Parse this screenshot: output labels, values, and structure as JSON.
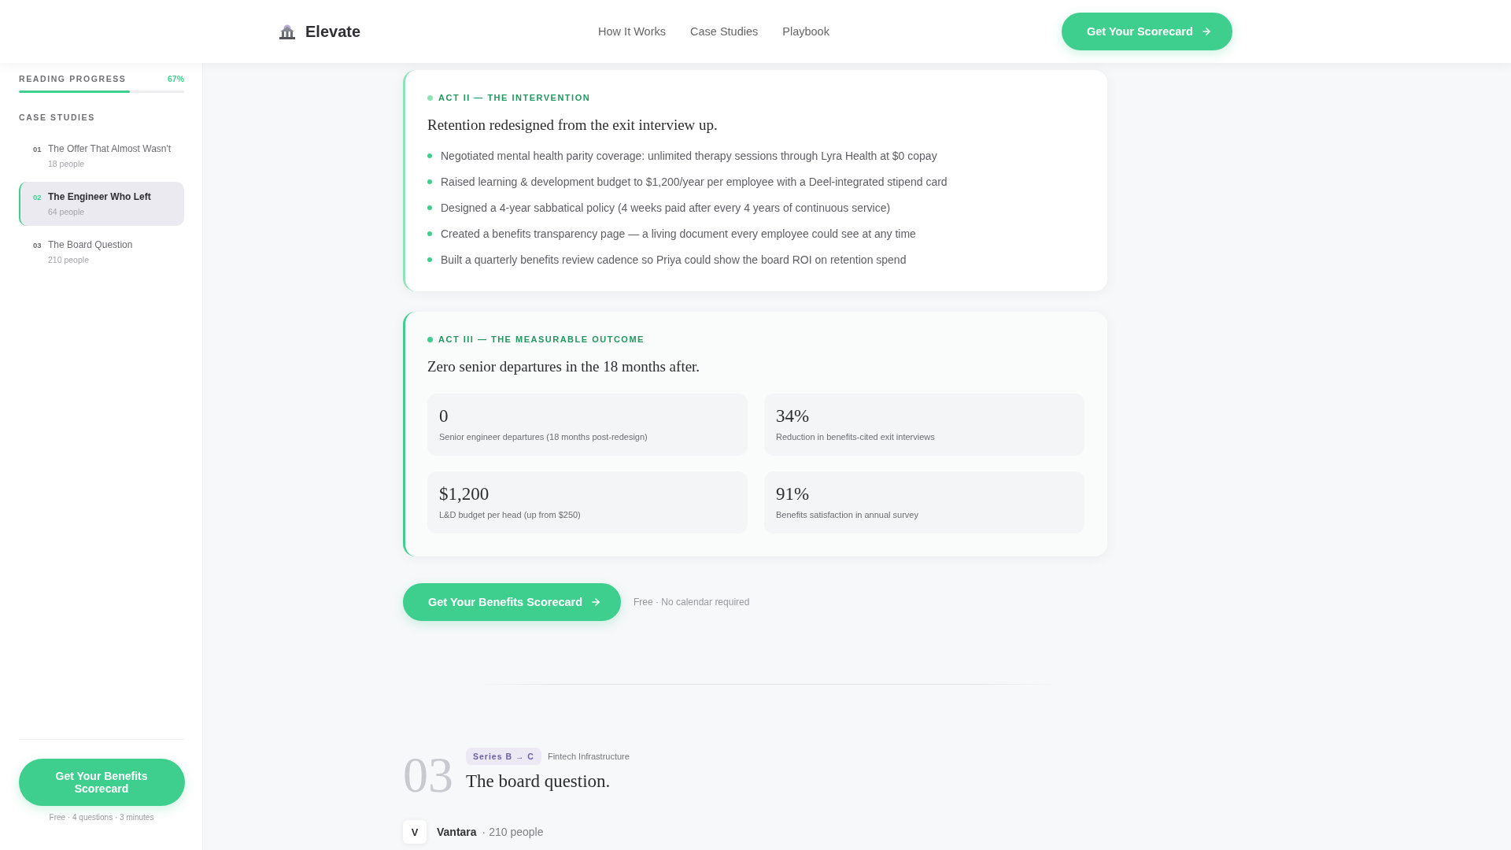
{
  "header": {
    "brand": "Elevate",
    "nav": [
      {
        "label": "How It Works"
      },
      {
        "label": "Case Studies"
      },
      {
        "label": "Playbook"
      }
    ],
    "cta": "Get Your Scorecard"
  },
  "sidebar": {
    "progress": {
      "label": "READING PROGRESS",
      "reading": "67%",
      "level": 0.67
    },
    "section_title": "CASE STUDIES",
    "items": [
      {
        "number": "01",
        "title": "The Offer That Almost Wasn't",
        "meta": "18 people",
        "selected": false
      },
      {
        "number": "02",
        "title": "The Engineer Who Left",
        "meta": "64 people",
        "selected": true
      },
      {
        "number": "03",
        "title": "The Board Question",
        "meta": "210 people",
        "selected": false
      }
    ],
    "cta": "Get Your Benefits Scorecard",
    "cta_note": "Free · 4 questions · 3 minutes"
  },
  "acts": [
    {
      "kind": "list",
      "label": "ACT II — THE INTERVENTION",
      "headline": "Retention redesigned from the exit interview up.",
      "items": [
        "Negotiated mental health parity coverage: unlimited therapy sessions through Lyra Health at $0 copay",
        "Raised learning & development budget to $1,200/year per employee with a Deel-integrated stipend card",
        "Designed a 4-year sabbatical policy (4 weeks paid after every 4 years of continuous service)",
        "Created a benefits transparency page — a living document every employee could see at any time",
        "Built a quarterly benefits review cadence so Priya could show the board ROI on retention spend"
      ]
    },
    {
      "kind": "stats",
      "label": "ACT III — THE MEASURABLE OUTCOME",
      "headline": "Zero senior departures in the 18 months after.",
      "stats": [
        {
          "value": "0",
          "caption": "Senior engineer departures (18 months post-redesign)"
        },
        {
          "value": "34%",
          "caption": "Reduction in benefits-cited exit interviews"
        },
        {
          "value": "$1,200",
          "caption": "L&D budget per head (up from $250)"
        },
        {
          "value": "91%",
          "caption": "Benefits satisfaction in annual survey"
        }
      ]
    }
  ],
  "cta": {
    "label": "Get Your Benefits Scorecard",
    "note": "Free · No calendar required"
  },
  "next_case": {
    "number": "03",
    "badge": "Series B → C",
    "industry": "Fintech Infrastructure",
    "title": "The board question.",
    "company": {
      "initial": "V",
      "name": "Vantara",
      "meta": "· 210 people"
    }
  }
}
